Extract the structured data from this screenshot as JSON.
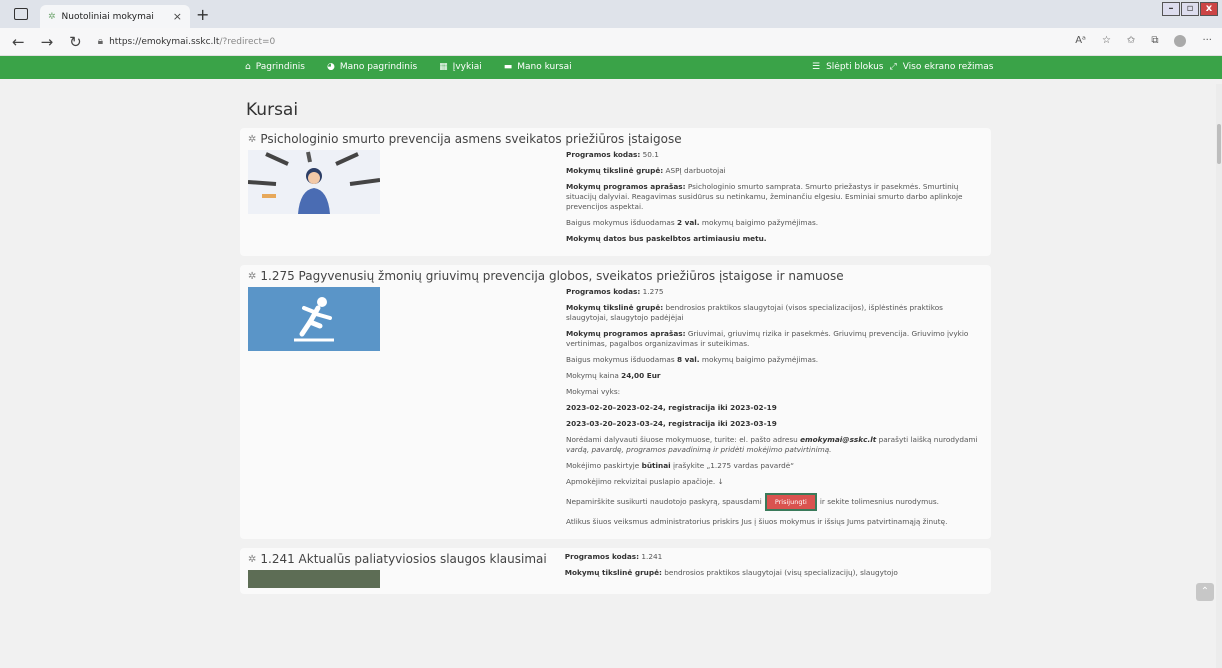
{
  "browser": {
    "tab_title": "Nuotoliniai mokymai",
    "close_glyph": "×",
    "newtab_glyph": "+",
    "url_main": "https://emokymai.sskc.lt",
    "url_path": "/?redirect=0"
  },
  "nav": {
    "items": [
      {
        "icon": "home-icon",
        "label": "Pagrindinis"
      },
      {
        "icon": "dashboard-icon",
        "label": "Mano pagrindinis"
      },
      {
        "icon": "calendar-icon",
        "label": "Įvykiai"
      },
      {
        "icon": "briefcase-icon",
        "label": "Mano kursai"
      }
    ],
    "hide_blocks": "Slėpti blokus",
    "fullscreen": "Viso ekrano režimas"
  },
  "page": {
    "title": "Kursai"
  },
  "courses": [
    {
      "title": "Psichologinio smurto prevencija asmens sveikatos priežiūros įstaigose",
      "code_label": "Programos kodas:",
      "code": "50.1",
      "group_label": "Mokymų tikslinė grupė:",
      "group": "ASPĮ darbuotojai",
      "desc_label": "Mokymų programos aprašas:",
      "desc": "Psichologinio smurto samprata. Smurto priežastys ir pasekmės. Smurtinių situacijų dalyviai. Reagavimas susidūrus su netinkamu, žeminančiu elgesiu. Esminiai smurto darbo aplinkoje prevencijos aspektai.",
      "cert_pre": "Baigus mokymus išduodamas",
      "cert_val": "2 val.",
      "cert_post": "mokymų baigimo pažymėjimas.",
      "dates_note": "Mokymų datos bus paskelbtos artimiausiu metu."
    },
    {
      "title": "1.275 Pagyvenusių žmonių griuvimų prevencija globos, sveikatos priežiūros įstaigose ir namuose",
      "code_label": "Programos kodas:",
      "code": "1.275",
      "group_label": "Mokymų tikslinė grupė:",
      "group": "bendrosios praktikos slaugytojai (visos specializacijos), išplėstinės praktikos slaugytojai, slaugytojo padėjėjai",
      "desc_label": "Mokymų programos aprašas:",
      "desc": "Griuvimai, griuvimų rizika ir pasekmės. Griuvimų prevencija. Griuvimo įvykio vertinimas, pagalbos organizavimas ir suteikimas.",
      "cert_pre": "Baigus mokymus išduodamas",
      "cert_val": "8 val.",
      "cert_post": "mokymų baigimo pažymėjimas.",
      "price_label": "Mokymų kaina",
      "price": "24,00 Eur",
      "held_label": "Mokymai vyks:",
      "dates": [
        "2023-02-20–2023-02-24, registracija iki 2023-02-19",
        "2023-03-20–2023-03-24, registracija iki 2023-03-19"
      ],
      "participate_pre": "Norėdami dalyvauti šiuose mokymuose, turite: el. pašto adresu",
      "participate_email": "emokymai@sskc.lt",
      "participate_mid": "parašyti laišką nurodydami",
      "participate_italic": "vardą, pavardę, programos pavadinimą ir pridėti mokėjimo patvirtinimą.",
      "payment_pre": "Mokėjimo paskirtyje",
      "payment_bold": "būtinai",
      "payment_post": "įrašykite „1.275 vardas pavardė“",
      "requisites": "Apmokėjimo rekvizitai puslapio apačioje. ↓",
      "account_pre": "Nepamirškite susikurti naudotojo paskyrą, spausdami",
      "login_button": "Prisijungti",
      "account_post": "ir sekite tolimesnius nurodymus.",
      "after": "Atlikus šiuos veiksmus administratorius priskirs Jus į šiuos mokymus ir išsiųs Jums patvirtinamąją žinutę."
    },
    {
      "title": "1.241 Aktualūs paliatyviosios slaugos klausimai",
      "code_label": "Programos kodas:",
      "code": "1.241",
      "group_label": "Mokymų tikslinė grupė:",
      "group": "bendrosios praktikos slaugytojai (visų specializacijų), slaugytojo"
    }
  ],
  "colors": {
    "nav_green": "#3aa348",
    "login_red": "#d9534f"
  }
}
